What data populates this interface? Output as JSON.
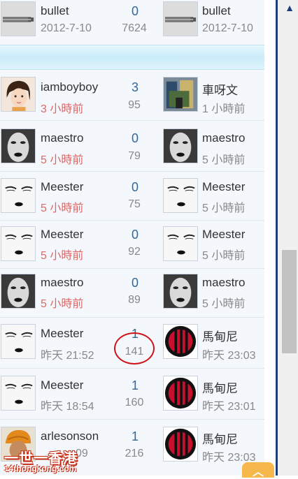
{
  "rows": [
    {
      "left_avatar": "bullet-icon",
      "left_name": "bullet",
      "left_time": "2012-7-10",
      "left_time_red": false,
      "replies": "0",
      "views": "7624",
      "right_avatar": "bullet-icon",
      "right_name": "bullet",
      "right_time": "2012-7-10"
    },
    {
      "left_avatar": "girl-avatar-icon",
      "left_name": "iamboyboy",
      "left_time": "3 小時前",
      "left_time_red": true,
      "replies": "3",
      "views": "95",
      "right_avatar": "photo-avatar-icon",
      "right_name": "車呀文",
      "right_time": "1 小時前"
    },
    {
      "left_avatar": "face-avatar-icon",
      "left_name": "maestro",
      "left_time": "5 小時前",
      "left_time_red": true,
      "replies": "0",
      "views": "79",
      "right_avatar": "face-avatar-icon",
      "right_name": "maestro",
      "right_time": "5 小時前"
    },
    {
      "left_avatar": "sketch-face-icon",
      "left_name": "Meester",
      "left_time": "5 小時前",
      "left_time_red": true,
      "replies": "0",
      "views": "75",
      "right_avatar": "sketch-face-icon",
      "right_name": "Meester",
      "right_time": "5 小時前"
    },
    {
      "left_avatar": "sketch-face-icon",
      "left_name": "Meester",
      "left_time": "5 小時前",
      "left_time_red": true,
      "replies": "0",
      "views": "92",
      "right_avatar": "sketch-face-icon",
      "right_name": "Meester",
      "right_time": "5 小時前"
    },
    {
      "left_avatar": "face-avatar-icon",
      "left_name": "maestro",
      "left_time": "5 小時前",
      "left_time_red": true,
      "replies": "0",
      "views": "89",
      "right_avatar": "face-avatar-icon",
      "right_name": "maestro",
      "right_time": "5 小時前"
    },
    {
      "left_avatar": "sketch-face-icon",
      "left_name": "Meester",
      "left_time": "昨天 21:52",
      "left_time_red": false,
      "replies": "1",
      "views": "141",
      "right_avatar": "ac-milan-crest-icon",
      "right_name": "馬甸尼",
      "right_time": "昨天 23:03"
    },
    {
      "left_avatar": "sketch-face-icon",
      "left_name": "Meester",
      "left_time": "昨天 18:54",
      "left_time_red": false,
      "replies": "1",
      "views": "160",
      "right_avatar": "ac-milan-crest-icon",
      "right_name": "馬甸尼",
      "right_time": "昨天 23:01"
    },
    {
      "left_avatar": "turban-avatar-icon",
      "left_name": "arlesonson",
      "left_time": "09",
      "left_time_red": false,
      "replies": "1",
      "views": "216",
      "right_avatar": "ac-milan-crest-icon",
      "right_name": "馬甸尼",
      "right_time": "昨天 23:03"
    }
  ],
  "watermark": {
    "title": "一世一香港",
    "url": "14thongkong.com"
  },
  "back_to_top_icon": "chevron-up-icon",
  "colors": {
    "accent": "#336699",
    "red_time": "#dd6666",
    "highlight_circle": "#d0131a"
  }
}
